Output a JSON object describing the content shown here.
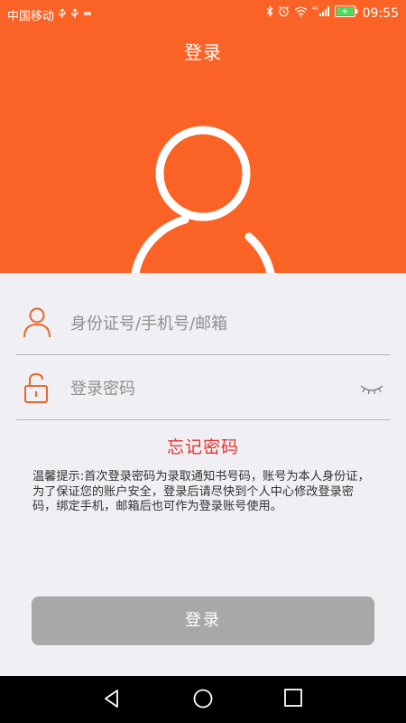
{
  "status_bar": {
    "carrier": "中国移动",
    "time": "09:55",
    "icons": [
      "usb-icon",
      "usb-icon",
      "notification-icon",
      "bluetooth-icon",
      "alarm-icon",
      "wifi-icon",
      "signal-4g-icon",
      "battery-charging-icon"
    ]
  },
  "header": {
    "title": "登录",
    "background_color": "#fb6225"
  },
  "form": {
    "username_placeholder": "身份证号/手机号/邮箱",
    "password_placeholder": "登录密码",
    "forgot_password": "忘记密码",
    "tip": "温馨提示:首次登录密码为录取通知书号码，账号为本人身份证，为了保证您的账户安全，登录后请尽快到个人中心修改登录密码，绑定手机，邮箱后也可作为登录账号使用。",
    "login_button": "登录",
    "accent_color": "#e8322c",
    "button_color": "#a8a8a8"
  },
  "nav_bar": {
    "buttons": [
      "back-icon",
      "home-icon",
      "recents-icon"
    ]
  }
}
